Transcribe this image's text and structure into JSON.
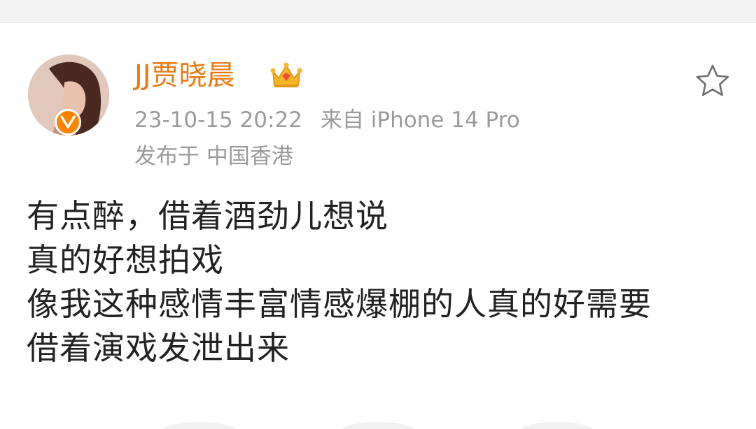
{
  "post": {
    "author": {
      "name": "JJ贾晓晨",
      "avatar_icon": "profile-photo",
      "verified_icon": "verified-v-badge",
      "badge_icon": "crown-icon"
    },
    "timestamp": "23-10-15 20:22",
    "source": "来自 iPhone 14 Pro",
    "location": "发布于 中国香港",
    "favorite_icon": "star-outline-icon",
    "lines": [
      "有点醉，借着酒劲儿想说",
      "真的好想拍戏",
      "像我这种感情丰富情感爆棚的人真的好需要",
      "借着演戏发泄出来"
    ]
  },
  "colors": {
    "username": "#eb7a14",
    "meta": "#9a9a9a",
    "body_text": "#222222",
    "verified_badge": "#ff8200"
  }
}
